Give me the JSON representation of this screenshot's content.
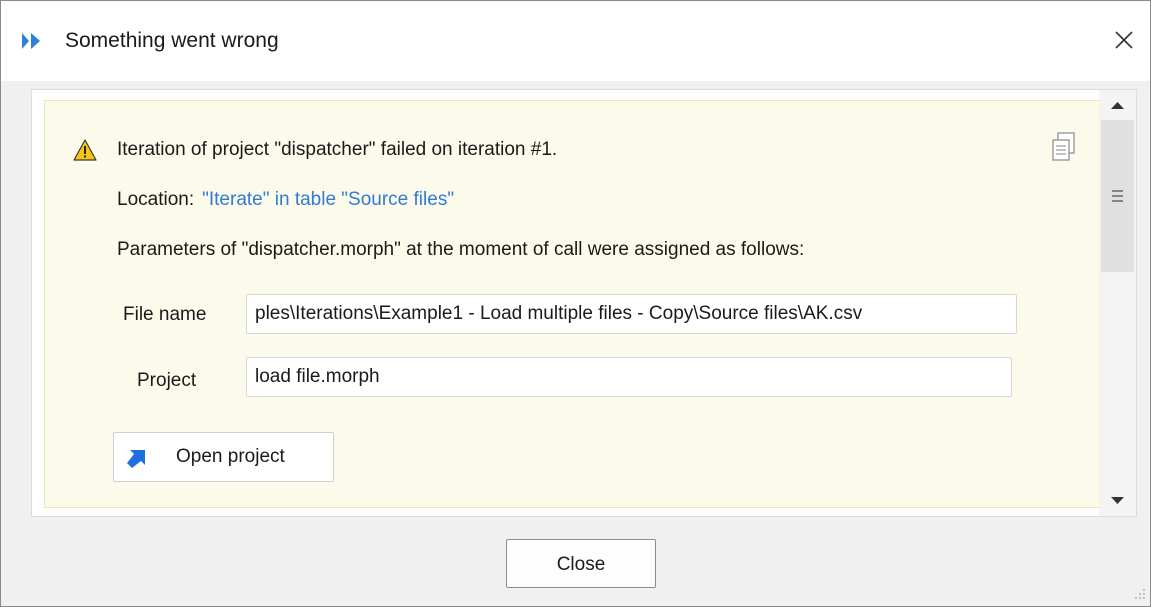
{
  "window": {
    "title": "Something went wrong"
  },
  "message": {
    "heading": "Iteration of project \"dispatcher\" failed on iteration #1.",
    "location_label": "Location:",
    "location_link": "\"Iterate\" in table \"Source files\"",
    "params_text": "Parameters of \"dispatcher.morph\" at the moment of call were assigned as follows:"
  },
  "params": [
    {
      "label": "File name",
      "value": "ples\\Iterations\\Example1 - Load multiple files - Copy\\Source files\\AK.csv"
    },
    {
      "label": "Project",
      "value": "load file.morph"
    }
  ],
  "open_project_label": "Open project",
  "close_label": "Close",
  "colors": {
    "link": "#2f7bd6",
    "panel_bg": "#fcfaea",
    "warning": "#f5c518",
    "accent": "#2f7bd6"
  },
  "icons": [
    "app-logo-icon",
    "close-icon",
    "warning-icon",
    "copy-icon",
    "open-arrow-icon",
    "scroll-up-icon",
    "scroll-down-icon",
    "scroll-grip-icon",
    "resize-grip-icon"
  ]
}
